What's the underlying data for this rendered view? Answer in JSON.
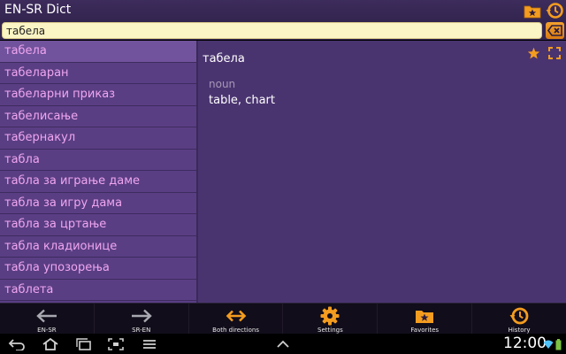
{
  "app": {
    "title": "EN-SR Dict"
  },
  "search": {
    "value": "табела"
  },
  "words": [
    "табела",
    "табеларан",
    "табеларни приказ",
    "табелисање",
    "табернакул",
    "табла",
    "табла за играње даме",
    "табла за игру дама",
    "табла за цртање",
    "табла кладионице",
    "табла упозорења",
    "таблета"
  ],
  "definition": {
    "word": "табела",
    "part_of_speech": "noun",
    "meaning": "table, chart"
  },
  "toolbar": {
    "en_sr": "EN-SR",
    "sr_en": "SR-EN",
    "both": "Both directions",
    "settings": "Settings",
    "favorites": "Favorites",
    "history": "History"
  },
  "status": {
    "time": "12:00"
  },
  "colors": {
    "accent": "#f39c1f",
    "list_background": "#5a3e84",
    "word_text": "#efa6ef",
    "definition_background": "#4a3470",
    "search_background": "#fbf4c4"
  }
}
